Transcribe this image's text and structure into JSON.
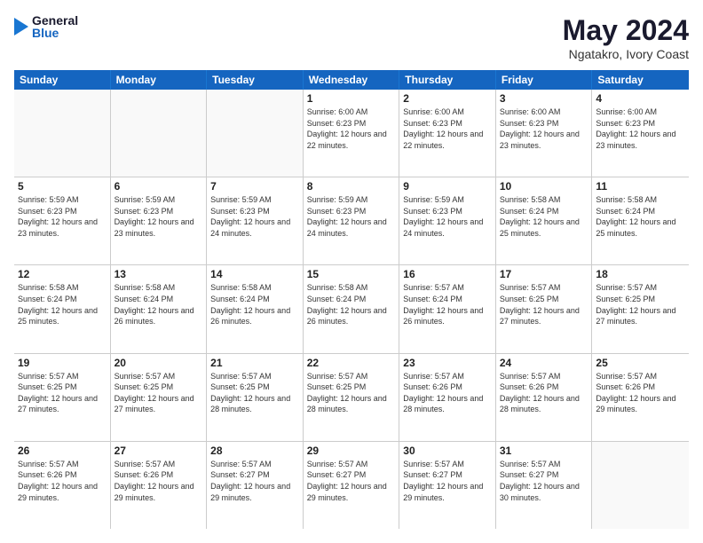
{
  "header": {
    "logo": {
      "general": "General",
      "blue": "Blue"
    },
    "title": "May 2024",
    "location": "Ngatakro, Ivory Coast"
  },
  "weekdays": [
    "Sunday",
    "Monday",
    "Tuesday",
    "Wednesday",
    "Thursday",
    "Friday",
    "Saturday"
  ],
  "rows": [
    [
      {
        "day": "",
        "info": ""
      },
      {
        "day": "",
        "info": ""
      },
      {
        "day": "",
        "info": ""
      },
      {
        "day": "1",
        "info": "Sunrise: 6:00 AM\nSunset: 6:23 PM\nDaylight: 12 hours\nand 22 minutes."
      },
      {
        "day": "2",
        "info": "Sunrise: 6:00 AM\nSunset: 6:23 PM\nDaylight: 12 hours\nand 22 minutes."
      },
      {
        "day": "3",
        "info": "Sunrise: 6:00 AM\nSunset: 6:23 PM\nDaylight: 12 hours\nand 23 minutes."
      },
      {
        "day": "4",
        "info": "Sunrise: 6:00 AM\nSunset: 6:23 PM\nDaylight: 12 hours\nand 23 minutes."
      }
    ],
    [
      {
        "day": "5",
        "info": "Sunrise: 5:59 AM\nSunset: 6:23 PM\nDaylight: 12 hours\nand 23 minutes."
      },
      {
        "day": "6",
        "info": "Sunrise: 5:59 AM\nSunset: 6:23 PM\nDaylight: 12 hours\nand 23 minutes."
      },
      {
        "day": "7",
        "info": "Sunrise: 5:59 AM\nSunset: 6:23 PM\nDaylight: 12 hours\nand 24 minutes."
      },
      {
        "day": "8",
        "info": "Sunrise: 5:59 AM\nSunset: 6:23 PM\nDaylight: 12 hours\nand 24 minutes."
      },
      {
        "day": "9",
        "info": "Sunrise: 5:59 AM\nSunset: 6:23 PM\nDaylight: 12 hours\nand 24 minutes."
      },
      {
        "day": "10",
        "info": "Sunrise: 5:58 AM\nSunset: 6:24 PM\nDaylight: 12 hours\nand 25 minutes."
      },
      {
        "day": "11",
        "info": "Sunrise: 5:58 AM\nSunset: 6:24 PM\nDaylight: 12 hours\nand 25 minutes."
      }
    ],
    [
      {
        "day": "12",
        "info": "Sunrise: 5:58 AM\nSunset: 6:24 PM\nDaylight: 12 hours\nand 25 minutes."
      },
      {
        "day": "13",
        "info": "Sunrise: 5:58 AM\nSunset: 6:24 PM\nDaylight: 12 hours\nand 26 minutes."
      },
      {
        "day": "14",
        "info": "Sunrise: 5:58 AM\nSunset: 6:24 PM\nDaylight: 12 hours\nand 26 minutes."
      },
      {
        "day": "15",
        "info": "Sunrise: 5:58 AM\nSunset: 6:24 PM\nDaylight: 12 hours\nand 26 minutes."
      },
      {
        "day": "16",
        "info": "Sunrise: 5:57 AM\nSunset: 6:24 PM\nDaylight: 12 hours\nand 26 minutes."
      },
      {
        "day": "17",
        "info": "Sunrise: 5:57 AM\nSunset: 6:25 PM\nDaylight: 12 hours\nand 27 minutes."
      },
      {
        "day": "18",
        "info": "Sunrise: 5:57 AM\nSunset: 6:25 PM\nDaylight: 12 hours\nand 27 minutes."
      }
    ],
    [
      {
        "day": "19",
        "info": "Sunrise: 5:57 AM\nSunset: 6:25 PM\nDaylight: 12 hours\nand 27 minutes."
      },
      {
        "day": "20",
        "info": "Sunrise: 5:57 AM\nSunset: 6:25 PM\nDaylight: 12 hours\nand 27 minutes."
      },
      {
        "day": "21",
        "info": "Sunrise: 5:57 AM\nSunset: 6:25 PM\nDaylight: 12 hours\nand 28 minutes."
      },
      {
        "day": "22",
        "info": "Sunrise: 5:57 AM\nSunset: 6:25 PM\nDaylight: 12 hours\nand 28 minutes."
      },
      {
        "day": "23",
        "info": "Sunrise: 5:57 AM\nSunset: 6:26 PM\nDaylight: 12 hours\nand 28 minutes."
      },
      {
        "day": "24",
        "info": "Sunrise: 5:57 AM\nSunset: 6:26 PM\nDaylight: 12 hours\nand 28 minutes."
      },
      {
        "day": "25",
        "info": "Sunrise: 5:57 AM\nSunset: 6:26 PM\nDaylight: 12 hours\nand 29 minutes."
      }
    ],
    [
      {
        "day": "26",
        "info": "Sunrise: 5:57 AM\nSunset: 6:26 PM\nDaylight: 12 hours\nand 29 minutes."
      },
      {
        "day": "27",
        "info": "Sunrise: 5:57 AM\nSunset: 6:26 PM\nDaylight: 12 hours\nand 29 minutes."
      },
      {
        "day": "28",
        "info": "Sunrise: 5:57 AM\nSunset: 6:27 PM\nDaylight: 12 hours\nand 29 minutes."
      },
      {
        "day": "29",
        "info": "Sunrise: 5:57 AM\nSunset: 6:27 PM\nDaylight: 12 hours\nand 29 minutes."
      },
      {
        "day": "30",
        "info": "Sunrise: 5:57 AM\nSunset: 6:27 PM\nDaylight: 12 hours\nand 29 minutes."
      },
      {
        "day": "31",
        "info": "Sunrise: 5:57 AM\nSunset: 6:27 PM\nDaylight: 12 hours\nand 30 minutes."
      },
      {
        "day": "",
        "info": ""
      }
    ]
  ]
}
